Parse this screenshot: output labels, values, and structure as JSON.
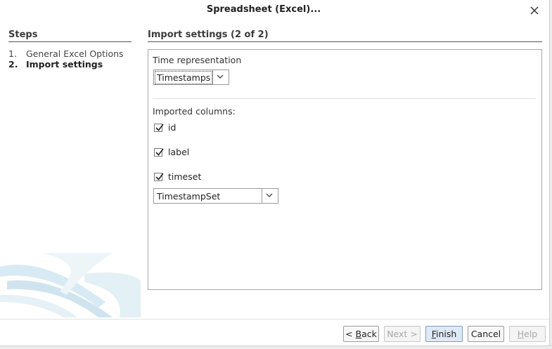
{
  "dialog": {
    "title": "Spreadsheet (Excel)..."
  },
  "steps": {
    "heading": "Steps",
    "items": [
      {
        "num": "1.",
        "label": "General Excel Options"
      },
      {
        "num": "2.",
        "label": "Import settings"
      }
    ]
  },
  "main": {
    "heading": "Import settings (2 of 2)",
    "time_rep_label": "Time representation",
    "time_rep_value": "Timestamps",
    "imported_columns_label": "Imported columns:",
    "columns": [
      {
        "label": "id",
        "checked": true
      },
      {
        "label": "label",
        "checked": true
      },
      {
        "label": "timeset",
        "checked": true
      }
    ],
    "timeset_type_value": "TimestampSet"
  },
  "buttons": {
    "back": {
      "pre": "< ",
      "mn": "B",
      "rest": "ack"
    },
    "next": {
      "label": "Next >"
    },
    "finish": {
      "mn": "F",
      "rest": "inish"
    },
    "cancel": {
      "label": "Cancel"
    },
    "help": {
      "mn": "H",
      "rest": "elp"
    }
  }
}
